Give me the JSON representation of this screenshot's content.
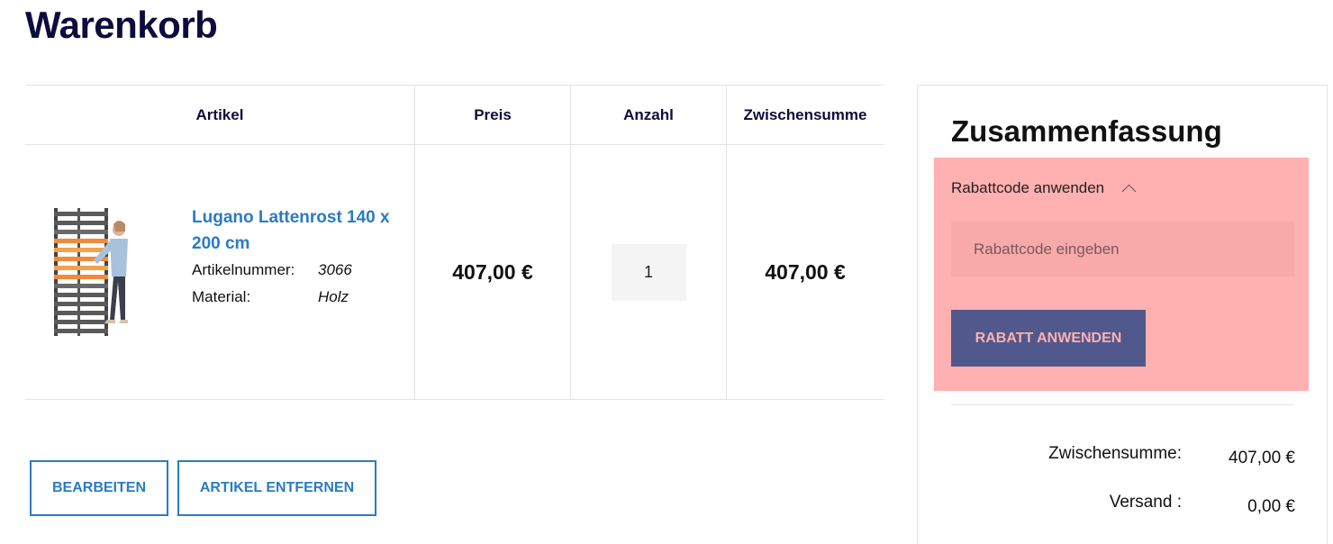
{
  "page": {
    "title": "Warenkorb"
  },
  "table": {
    "headers": {
      "item": "Artikel",
      "price": "Preis",
      "quantity": "Anzahl",
      "subtotal": "Zwischensumme"
    },
    "rows": [
      {
        "name": "Lugano Lattenrost 140 x 200 cm",
        "image_alt": "Lugano Lattenrost 140 x 200 cm",
        "specs": [
          {
            "label": "Artikelnummer:",
            "value": "3066"
          },
          {
            "label": "Material:",
            "value": "Holz"
          }
        ],
        "price": "407,00 €",
        "quantity": "1",
        "subtotal": "407,00 €"
      }
    ]
  },
  "actions": {
    "edit_label": "BEARBEITEN",
    "remove_label": "ARTIKEL ENTFERNEN"
  },
  "summary": {
    "title": "Zusammenfassung",
    "discount": {
      "toggle_label": "Rabattcode anwenden",
      "input_placeholder": "Rabattcode eingeben",
      "input_value": "",
      "apply_label": "RABATT ANWENDEN"
    },
    "totals": [
      {
        "label": "Zwischensumme:",
        "value": "407,00 €"
      },
      {
        "label": "Versand :",
        "value": "0,00 €"
      }
    ]
  },
  "colors": {
    "title": "#0d0c3d",
    "link": "#2a7bc4",
    "discount_panel": "#ffb0b0",
    "apply_button": "#51598c"
  }
}
